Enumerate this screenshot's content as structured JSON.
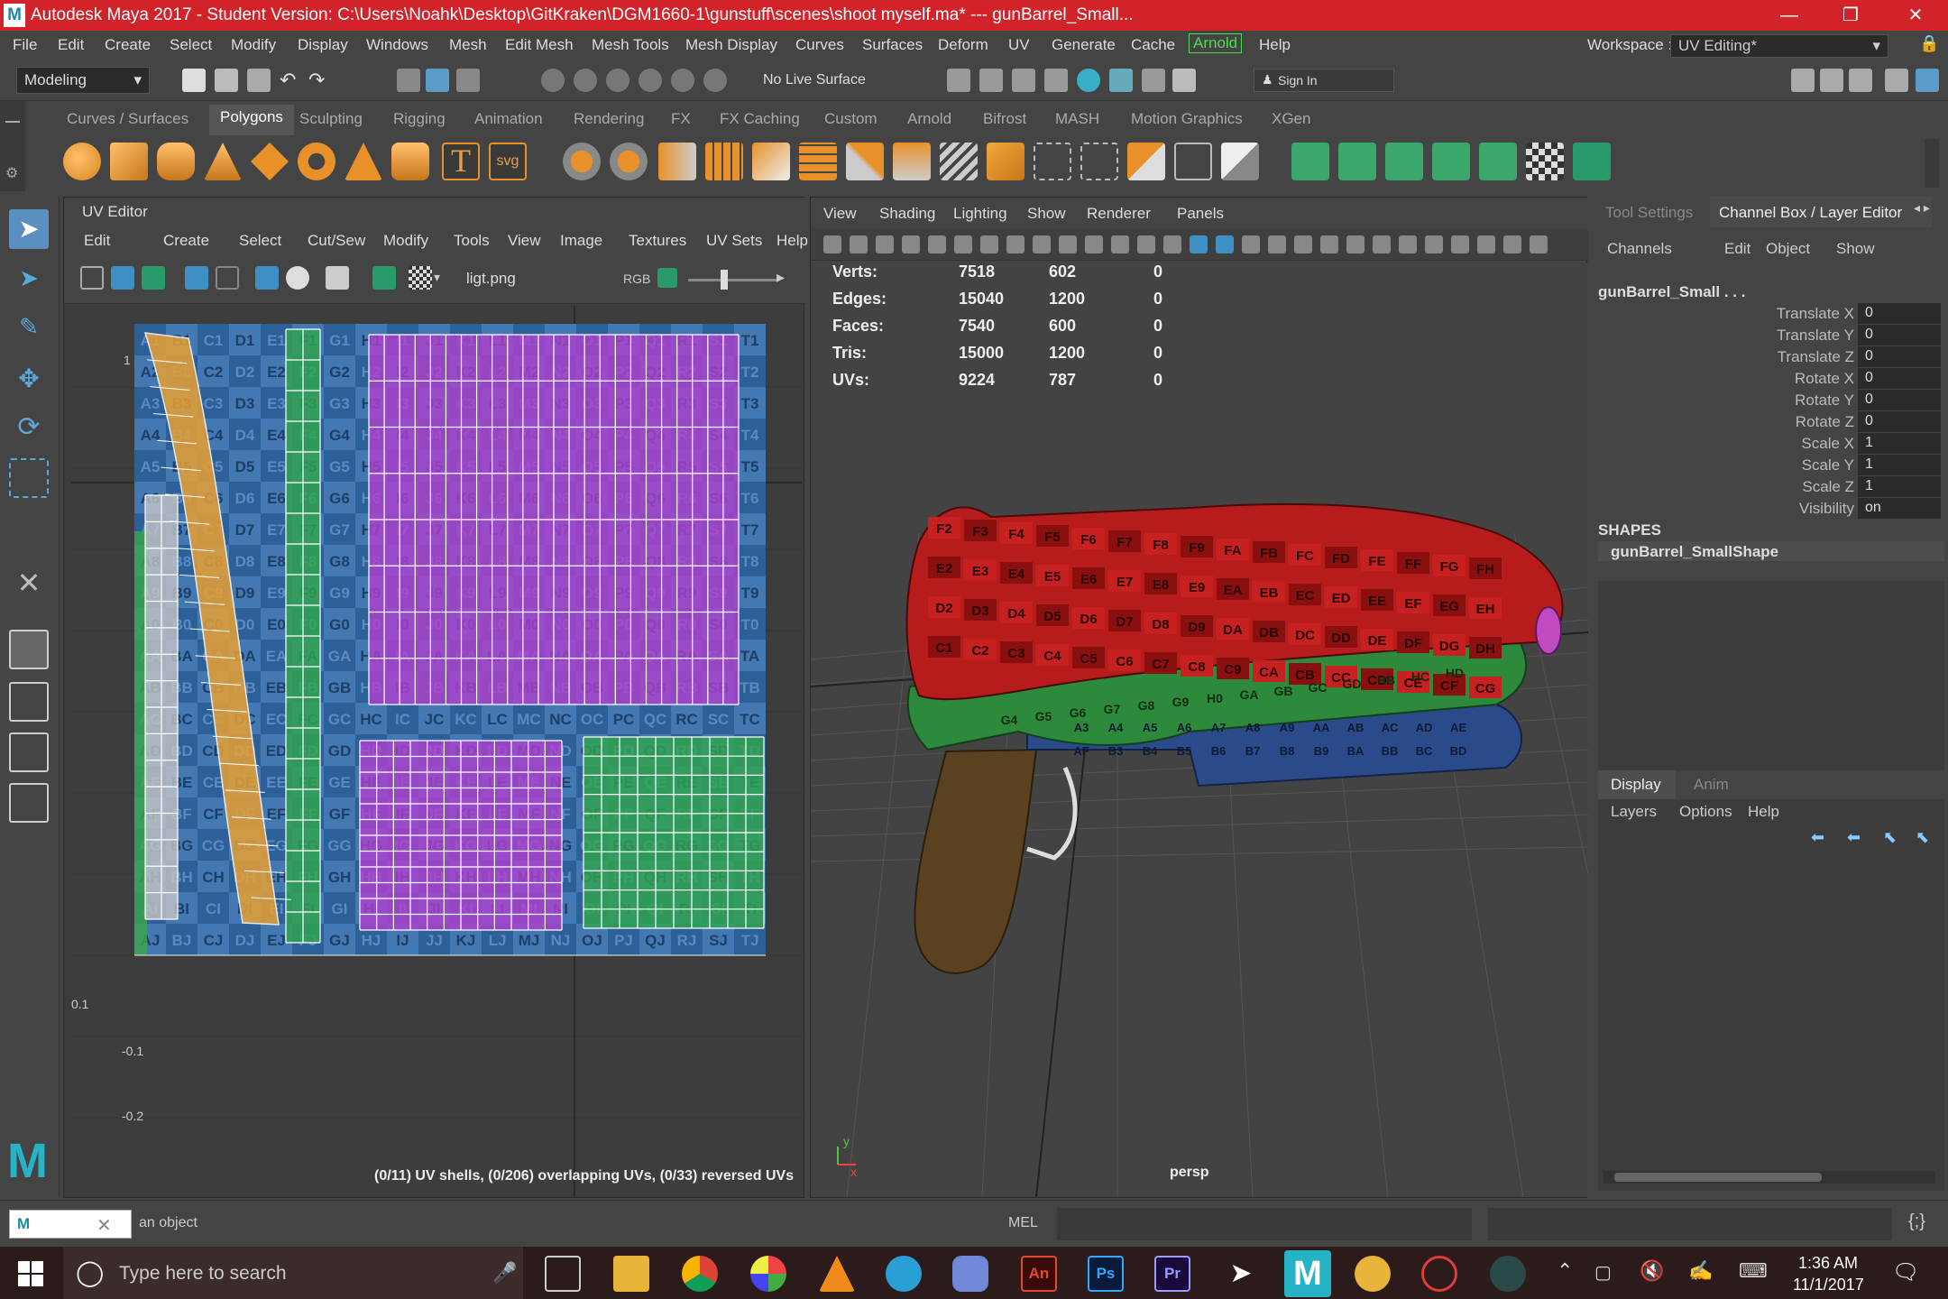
{
  "window": {
    "title": "Autodesk Maya 2017 - Student Version: C:\\Users\\Noahk\\Desktop\\GitKraken\\DGM1660-1\\gunstuff\\scenes\\shoot myself.ma*   ---   gunBarrel_Small...",
    "logo": "M"
  },
  "menubar": {
    "items": [
      "File",
      "Edit",
      "Create",
      "Select",
      "Modify",
      "Display",
      "Windows",
      "Mesh",
      "Edit Mesh",
      "Mesh Tools",
      "Mesh Display",
      "Curves",
      "Surfaces",
      "Deform",
      "UV",
      "Generate",
      "Cache",
      "Arnold",
      "Help"
    ],
    "workspace_label": "Workspace :",
    "workspace_value": "UV Editing*"
  },
  "statusline": {
    "mode": "Modeling",
    "live_surface": "No Live Surface",
    "sign_in": "Sign In"
  },
  "shelf": {
    "tabs": [
      "Curves / Surfaces",
      "Polygons",
      "Sculpting",
      "Rigging",
      "Animation",
      "Rendering",
      "FX",
      "FX Caching",
      "Custom",
      "Arnold",
      "Bifrost",
      "MASH",
      "Motion Graphics",
      "XGen"
    ],
    "active_tab": "Polygons",
    "text_icon": "T",
    "svg_icon": "svg"
  },
  "uv_editor": {
    "title": "UV Editor",
    "menu": [
      "Edit",
      "Create",
      "Select",
      "Cut/Sew",
      "Modify",
      "Tools",
      "View",
      "Image",
      "Textures",
      "UV Sets",
      "Help"
    ],
    "image_name": "ligt.png",
    "rgb_label": "RGB",
    "axis_labels": [
      "1",
      "0.1",
      "-0.1",
      "-0.2"
    ],
    "status": "(0/11) UV shells, (0/206) overlapping UVs, (0/33) reversed UVs",
    "grid_rows": [
      "1",
      "2",
      "3",
      "4",
      "5",
      "6",
      "7",
      "8",
      "9",
      "0",
      "A",
      "B",
      "C",
      "D",
      "E",
      "F",
      "G",
      "H",
      "I",
      "J"
    ],
    "grid_cols": [
      "A",
      "B",
      "C",
      "D",
      "E",
      "F",
      "G",
      "H",
      "I",
      "J",
      "K",
      "L",
      "M",
      "N",
      "O",
      "P",
      "Q",
      "R",
      "S",
      "T"
    ]
  },
  "viewport": {
    "menu": [
      "View",
      "Shading",
      "Lighting",
      "Show",
      "Renderer",
      "Panels"
    ],
    "stats": [
      {
        "label": "Verts:",
        "a": "7518",
        "b": "602",
        "c": "0"
      },
      {
        "label": "Edges:",
        "a": "15040",
        "b": "1200",
        "c": "0"
      },
      {
        "label": "Faces:",
        "a": "7540",
        "b": "600",
        "c": "0"
      },
      {
        "label": "Tris:",
        "a": "15000",
        "b": "1200",
        "c": "0"
      },
      {
        "label": "UVs:",
        "a": "9224",
        "b": "787",
        "c": "0"
      }
    ],
    "camera": "persp",
    "axis_x": "x",
    "axis_y": "y",
    "gun_labels_red": [
      "F2",
      "F3",
      "F4",
      "F5",
      "F6",
      "F7",
      "F8",
      "F9",
      "FA",
      "FB",
      "FC",
      "FD",
      "FE",
      "FF",
      "FG",
      "FH",
      "E2",
      "E3",
      "E4",
      "E5",
      "E6",
      "E7",
      "E8",
      "E9",
      "EA",
      "EB",
      "EC",
      "ED",
      "EE",
      "EF",
      "EG",
      "EH",
      "D2",
      "D3",
      "D4",
      "D5",
      "D6",
      "D7",
      "D8",
      "D9",
      "DA",
      "DB",
      "DC",
      "DD",
      "DE",
      "DF",
      "DG",
      "DH",
      "C1",
      "C2",
      "C3",
      "C4",
      "C5",
      "C6",
      "C7",
      "C8",
      "C9",
      "CA",
      "CB",
      "CC",
      "CD",
      "CE",
      "CF",
      "CG"
    ],
    "gun_labels_green": [
      "G4",
      "G5",
      "G6",
      "G7",
      "G8",
      "G9",
      "H0",
      "GA",
      "GB",
      "GC",
      "GD",
      "HB",
      "HC",
      "HD"
    ],
    "gun_labels_blue": [
      "A3",
      "A4",
      "A5",
      "A6",
      "A7",
      "A8",
      "A9",
      "AA",
      "AB",
      "AC",
      "AD",
      "AE",
      "AF",
      "B3",
      "B4",
      "B5",
      "B6",
      "B7",
      "B8",
      "B9",
      "BA",
      "BB",
      "BC",
      "BD"
    ]
  },
  "channel_box": {
    "tabs": [
      "Tool Settings",
      "Channel Box / Layer Editor"
    ],
    "menu": [
      "Channels",
      "Edit",
      "Object",
      "Show"
    ],
    "object_name": "gunBarrel_Small . . .",
    "attributes": [
      {
        "label": "Translate X",
        "value": "0"
      },
      {
        "label": "Translate Y",
        "value": "0"
      },
      {
        "label": "Translate Z",
        "value": "0"
      },
      {
        "label": "Rotate X",
        "value": "0"
      },
      {
        "label": "Rotate Y",
        "value": "0"
      },
      {
        "label": "Rotate Z",
        "value": "0"
      },
      {
        "label": "Scale X",
        "value": "1"
      },
      {
        "label": "Scale Y",
        "value": "1"
      },
      {
        "label": "Scale Z",
        "value": "1"
      },
      {
        "label": "Visibility",
        "value": "on"
      }
    ],
    "shapes_header": "SHAPES",
    "shape_name": "gunBarrel_SmallShape",
    "layer_tabs": [
      "Display",
      "Anim"
    ],
    "layer_menu": [
      "Layers",
      "Options",
      "Help"
    ]
  },
  "command_line": {
    "help_text": "an object",
    "language": "MEL"
  },
  "taskbar": {
    "search_placeholder": "Type here to search",
    "time": "1:36 AM",
    "date": "11/1/2017"
  }
}
